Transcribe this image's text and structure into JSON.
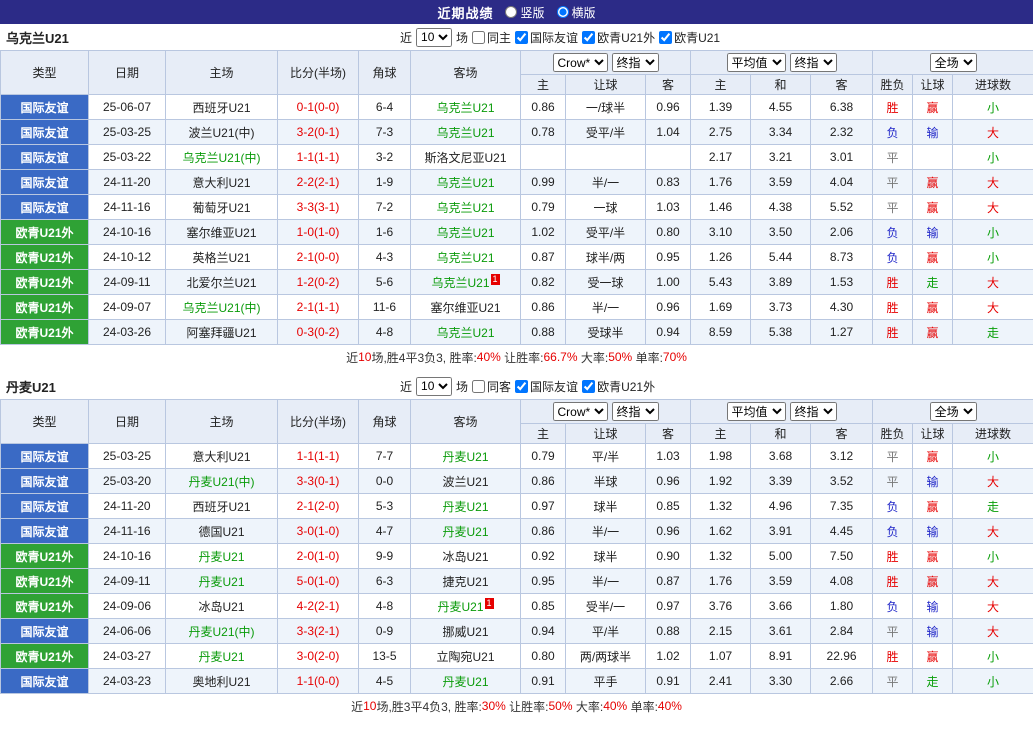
{
  "topbar": {
    "title": "近期战绩",
    "radios": [
      {
        "label": "竖版",
        "selected": false
      },
      {
        "label": "横版",
        "selected": true
      }
    ]
  },
  "table_header": {
    "type": "类型",
    "date": "日期",
    "home": "主场",
    "score": "比分(半场)",
    "corner": "角球",
    "away": "客场",
    "odds_company": "Crow*",
    "odds_stage": "终指",
    "avg_label": "平均值",
    "avg_stage": "终指",
    "scope": "全场",
    "odds_cols": [
      "主",
      "让球",
      "客"
    ],
    "avg_cols": [
      "主",
      "和",
      "客"
    ],
    "result_cols": [
      "胜负",
      "让球",
      "进球数"
    ]
  },
  "colors": {
    "r": "#e60000",
    "b": "#2026c8",
    "g": "#089e08",
    "y": "#777777",
    "type_blue": "#3a6ac5",
    "type_green": "#2fa235",
    "team_green": "#0a9b0a",
    "score_red": "#e60000",
    "topbar_bg": "#2c2b87"
  },
  "sections": [
    {
      "team": "乌克兰U21",
      "filter": {
        "near": "近",
        "count": "10",
        "games": "场",
        "checks": [
          {
            "label": "同主",
            "checked": false
          },
          {
            "label": "国际友谊",
            "checked": true
          },
          {
            "label": "欧青U21外",
            "checked": true
          },
          {
            "label": "欧青U21",
            "checked": true
          }
        ]
      },
      "rows": [
        {
          "type": "国际友谊",
          "tc": "type_blue",
          "date": "25-06-07",
          "home": "西班牙U21",
          "hg": false,
          "score": "0-1(0-0)",
          "corner": "6-4",
          "away": "乌克兰U21",
          "ag": true,
          "badge": "",
          "o": [
            "0.86",
            "一/球半",
            "0.96"
          ],
          "v": [
            "1.39",
            "4.55",
            "6.38"
          ],
          "res": [
            [
              "胜",
              "r"
            ],
            [
              "赢",
              "r"
            ],
            [
              "小",
              "g"
            ]
          ]
        },
        {
          "type": "国际友谊",
          "tc": "type_blue",
          "date": "25-03-25",
          "home": "波兰U21(中)",
          "hg": false,
          "score": "3-2(0-1)",
          "corner": "7-3",
          "away": "乌克兰U21",
          "ag": true,
          "badge": "",
          "o": [
            "0.78",
            "受平/半",
            "1.04"
          ],
          "v": [
            "2.75",
            "3.34",
            "2.32"
          ],
          "res": [
            [
              "负",
              "b"
            ],
            [
              "输",
              "b"
            ],
            [
              "大",
              "r"
            ]
          ]
        },
        {
          "type": "国际友谊",
          "tc": "type_blue",
          "date": "25-03-22",
          "home": "乌克兰U21(中)",
          "hg": true,
          "score": "1-1(1-1)",
          "corner": "3-2",
          "away": "斯洛文尼亚U21",
          "ag": false,
          "badge": "",
          "o": [
            "",
            "",
            ""
          ],
          "v": [
            "2.17",
            "3.21",
            "3.01"
          ],
          "res": [
            [
              "平",
              "y"
            ],
            [
              "",
              ""
            ],
            [
              "小",
              "g"
            ]
          ]
        },
        {
          "type": "国际友谊",
          "tc": "type_blue",
          "date": "24-11-20",
          "home": "意大利U21",
          "hg": false,
          "score": "2-2(2-1)",
          "corner": "1-9",
          "away": "乌克兰U21",
          "ag": true,
          "badge": "",
          "o": [
            "0.99",
            "半/一",
            "0.83"
          ],
          "v": [
            "1.76",
            "3.59",
            "4.04"
          ],
          "res": [
            [
              "平",
              "y"
            ],
            [
              "赢",
              "r"
            ],
            [
              "大",
              "r"
            ]
          ]
        },
        {
          "type": "国际友谊",
          "tc": "type_blue",
          "date": "24-11-16",
          "home": "葡萄牙U21",
          "hg": false,
          "score": "3-3(3-1)",
          "corner": "7-2",
          "away": "乌克兰U21",
          "ag": true,
          "badge": "",
          "o": [
            "0.79",
            "一球",
            "1.03"
          ],
          "v": [
            "1.46",
            "4.38",
            "5.52"
          ],
          "res": [
            [
              "平",
              "y"
            ],
            [
              "赢",
              "r"
            ],
            [
              "大",
              "r"
            ]
          ]
        },
        {
          "type": "欧青U21外",
          "tc": "type_green",
          "date": "24-10-16",
          "home": "塞尔维亚U21",
          "hg": false,
          "score": "1-0(1-0)",
          "corner": "1-6",
          "away": "乌克兰U21",
          "ag": true,
          "badge": "",
          "o": [
            "1.02",
            "受平/半",
            "0.80"
          ],
          "v": [
            "3.10",
            "3.50",
            "2.06"
          ],
          "res": [
            [
              "负",
              "b"
            ],
            [
              "输",
              "b"
            ],
            [
              "小",
              "g"
            ]
          ]
        },
        {
          "type": "欧青U21外",
          "tc": "type_green",
          "date": "24-10-12",
          "home": "英格兰U21",
          "hg": false,
          "score": "2-1(0-0)",
          "corner": "4-3",
          "away": "乌克兰U21",
          "ag": true,
          "badge": "",
          "o": [
            "0.87",
            "球半/两",
            "0.95"
          ],
          "v": [
            "1.26",
            "5.44",
            "8.73"
          ],
          "res": [
            [
              "负",
              "b"
            ],
            [
              "赢",
              "r"
            ],
            [
              "小",
              "g"
            ]
          ]
        },
        {
          "type": "欧青U21外",
          "tc": "type_green",
          "date": "24-09-11",
          "home": "北爱尔兰U21",
          "hg": false,
          "score": "1-2(0-2)",
          "corner": "5-6",
          "away": "乌克兰U21",
          "ag": true,
          "badge": "1",
          "o": [
            "0.82",
            "受一球",
            "1.00"
          ],
          "v": [
            "5.43",
            "3.89",
            "1.53"
          ],
          "res": [
            [
              "胜",
              "r"
            ],
            [
              "走",
              "g"
            ],
            [
              "大",
              "r"
            ]
          ]
        },
        {
          "type": "欧青U21外",
          "tc": "type_green",
          "date": "24-09-07",
          "home": "乌克兰U21(中)",
          "hg": true,
          "score": "2-1(1-1)",
          "corner": "11-6",
          "away": "塞尔维亚U21",
          "ag": false,
          "badge": "",
          "o": [
            "0.86",
            "半/一",
            "0.96"
          ],
          "v": [
            "1.69",
            "3.73",
            "4.30"
          ],
          "res": [
            [
              "胜",
              "r"
            ],
            [
              "赢",
              "r"
            ],
            [
              "大",
              "r"
            ]
          ]
        },
        {
          "type": "欧青U21外",
          "tc": "type_green",
          "date": "24-03-26",
          "home": "阿塞拜疆U21",
          "hg": false,
          "score": "0-3(0-2)",
          "corner": "4-8",
          "away": "乌克兰U21",
          "ag": true,
          "badge": "",
          "o": [
            "0.88",
            "受球半",
            "0.94"
          ],
          "v": [
            "8.59",
            "5.38",
            "1.27"
          ],
          "res": [
            [
              "胜",
              "r"
            ],
            [
              "赢",
              "r"
            ],
            [
              "走",
              "g"
            ]
          ]
        }
      ],
      "summary": [
        {
          "t": "近",
          "c": "#333333"
        },
        {
          "t": "10",
          "c": "#e60000"
        },
        {
          "t": "场,胜4平3负3, 胜率:",
          "c": "#333333"
        },
        {
          "t": "40%",
          "c": "#e60000"
        },
        {
          "t": " 让胜率:",
          "c": "#333333"
        },
        {
          "t": "66.7%",
          "c": "#e60000"
        },
        {
          "t": " 大率:",
          "c": "#333333"
        },
        {
          "t": "50%",
          "c": "#e60000"
        },
        {
          "t": " 单率:",
          "c": "#333333"
        },
        {
          "t": "70%",
          "c": "#e60000"
        }
      ]
    },
    {
      "team": "丹麦U21",
      "filter": {
        "near": "近",
        "count": "10",
        "games": "场",
        "checks": [
          {
            "label": "同客",
            "checked": false
          },
          {
            "label": "国际友谊",
            "checked": true
          },
          {
            "label": "欧青U21外",
            "checked": true
          }
        ]
      },
      "rows": [
        {
          "type": "国际友谊",
          "tc": "type_blue",
          "date": "25-03-25",
          "home": "意大利U21",
          "hg": false,
          "score": "1-1(1-1)",
          "corner": "7-7",
          "away": "丹麦U21",
          "ag": true,
          "badge": "",
          "o": [
            "0.79",
            "平/半",
            "1.03"
          ],
          "v": [
            "1.98",
            "3.68",
            "3.12"
          ],
          "res": [
            [
              "平",
              "y"
            ],
            [
              "赢",
              "r"
            ],
            [
              "小",
              "g"
            ]
          ]
        },
        {
          "type": "国际友谊",
          "tc": "type_blue",
          "date": "25-03-20",
          "home": "丹麦U21(中)",
          "hg": true,
          "score": "3-3(0-1)",
          "corner": "0-0",
          "away": "波兰U21",
          "ag": false,
          "badge": "",
          "o": [
            "0.86",
            "半球",
            "0.96"
          ],
          "v": [
            "1.92",
            "3.39",
            "3.52"
          ],
          "res": [
            [
              "平",
              "y"
            ],
            [
              "输",
              "b"
            ],
            [
              "大",
              "r"
            ]
          ]
        },
        {
          "type": "国际友谊",
          "tc": "type_blue",
          "date": "24-11-20",
          "home": "西班牙U21",
          "hg": false,
          "score": "2-1(2-0)",
          "corner": "5-3",
          "away": "丹麦U21",
          "ag": true,
          "badge": "",
          "o": [
            "0.97",
            "球半",
            "0.85"
          ],
          "v": [
            "1.32",
            "4.96",
            "7.35"
          ],
          "res": [
            [
              "负",
              "b"
            ],
            [
              "赢",
              "r"
            ],
            [
              "走",
              "g"
            ]
          ]
        },
        {
          "type": "国际友谊",
          "tc": "type_blue",
          "date": "24-11-16",
          "home": "德国U21",
          "hg": false,
          "score": "3-0(1-0)",
          "corner": "4-7",
          "away": "丹麦U21",
          "ag": true,
          "badge": "",
          "o": [
            "0.86",
            "半/一",
            "0.96"
          ],
          "v": [
            "1.62",
            "3.91",
            "4.45"
          ],
          "res": [
            [
              "负",
              "b"
            ],
            [
              "输",
              "b"
            ],
            [
              "大",
              "r"
            ]
          ]
        },
        {
          "type": "欧青U21外",
          "tc": "type_green",
          "date": "24-10-16",
          "home": "丹麦U21",
          "hg": true,
          "score": "2-0(1-0)",
          "corner": "9-9",
          "away": "冰岛U21",
          "ag": false,
          "badge": "",
          "o": [
            "0.92",
            "球半",
            "0.90"
          ],
          "v": [
            "1.32",
            "5.00",
            "7.50"
          ],
          "res": [
            [
              "胜",
              "r"
            ],
            [
              "赢",
              "r"
            ],
            [
              "小",
              "g"
            ]
          ]
        },
        {
          "type": "欧青U21外",
          "tc": "type_green",
          "date": "24-09-11",
          "home": "丹麦U21",
          "hg": true,
          "score": "5-0(1-0)",
          "corner": "6-3",
          "away": "捷克U21",
          "ag": false,
          "badge": "",
          "o": [
            "0.95",
            "半/一",
            "0.87"
          ],
          "v": [
            "1.76",
            "3.59",
            "4.08"
          ],
          "res": [
            [
              "胜",
              "r"
            ],
            [
              "赢",
              "r"
            ],
            [
              "大",
              "r"
            ]
          ]
        },
        {
          "type": "欧青U21外",
          "tc": "type_green",
          "date": "24-09-06",
          "home": "冰岛U21",
          "hg": false,
          "score": "4-2(2-1)",
          "corner": "4-8",
          "away": "丹麦U21",
          "ag": true,
          "badge": "1",
          "o": [
            "0.85",
            "受半/一",
            "0.97"
          ],
          "v": [
            "3.76",
            "3.66",
            "1.80"
          ],
          "res": [
            [
              "负",
              "b"
            ],
            [
              "输",
              "b"
            ],
            [
              "大",
              "r"
            ]
          ]
        },
        {
          "type": "国际友谊",
          "tc": "type_blue",
          "date": "24-06-06",
          "home": "丹麦U21(中)",
          "hg": true,
          "score": "3-3(2-1)",
          "corner": "0-9",
          "away": "挪威U21",
          "ag": false,
          "badge": "",
          "o": [
            "0.94",
            "平/半",
            "0.88"
          ],
          "v": [
            "2.15",
            "3.61",
            "2.84"
          ],
          "res": [
            [
              "平",
              "y"
            ],
            [
              "输",
              "b"
            ],
            [
              "大",
              "r"
            ]
          ]
        },
        {
          "type": "欧青U21外",
          "tc": "type_green",
          "date": "24-03-27",
          "home": "丹麦U21",
          "hg": true,
          "score": "3-0(2-0)",
          "corner": "13-5",
          "away": "立陶宛U21",
          "ag": false,
          "badge": "",
          "o": [
            "0.80",
            "两/两球半",
            "1.02"
          ],
          "v": [
            "1.07",
            "8.91",
            "22.96"
          ],
          "res": [
            [
              "胜",
              "r"
            ],
            [
              "赢",
              "r"
            ],
            [
              "小",
              "g"
            ]
          ]
        },
        {
          "type": "国际友谊",
          "tc": "type_blue",
          "date": "24-03-23",
          "home": "奥地利U21",
          "hg": false,
          "score": "1-1(0-0)",
          "corner": "4-5",
          "away": "丹麦U21",
          "ag": true,
          "badge": "",
          "o": [
            "0.91",
            "平手",
            "0.91"
          ],
          "v": [
            "2.41",
            "3.30",
            "2.66"
          ],
          "res": [
            [
              "平",
              "y"
            ],
            [
              "走",
              "g"
            ],
            [
              "小",
              "g"
            ]
          ]
        }
      ],
      "summary": [
        {
          "t": "近",
          "c": "#333333"
        },
        {
          "t": "10",
          "c": "#e60000"
        },
        {
          "t": "场,胜3平4负3, 胜率:",
          "c": "#333333"
        },
        {
          "t": "30%",
          "c": "#e60000"
        },
        {
          "t": " 让胜率:",
          "c": "#333333"
        },
        {
          "t": "50%",
          "c": "#e60000"
        },
        {
          "t": " 大率:",
          "c": "#333333"
        },
        {
          "t": "40%",
          "c": "#e60000"
        },
        {
          "t": " 单率:",
          "c": "#333333"
        },
        {
          "t": "40%",
          "c": "#e60000"
        }
      ]
    }
  ]
}
